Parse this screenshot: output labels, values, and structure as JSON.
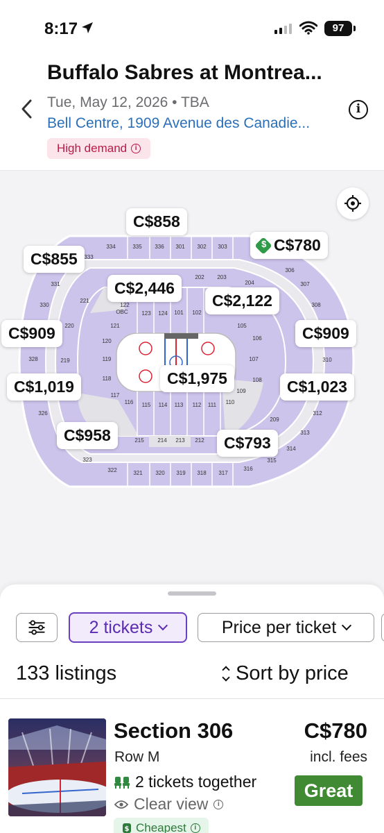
{
  "status_bar": {
    "time": "8:17",
    "battery": "97"
  },
  "header": {
    "title": "Buffalo Sabres at Montrea...",
    "date_time": "Tue, May 12, 2026 • TBA",
    "venue": "Bell Centre, 1909 Avenue des Canadie...",
    "demand_badge": "High demand",
    "icons": [
      "back-chevron-icon",
      "info-icon"
    ]
  },
  "map": {
    "section_labels": [
      "334",
      "335",
      "336",
      "301",
      "302",
      "303",
      "333",
      "306",
      "307",
      "308",
      "331",
      "330",
      "221",
      "220",
      "219",
      "122",
      "123",
      "124",
      "101",
      "102",
      "105",
      "106",
      "107",
      "108",
      "310",
      "121",
      "120",
      "119",
      "118",
      "117",
      "116",
      "115",
      "114",
      "113",
      "112",
      "111",
      "110",
      "109",
      "328",
      "326",
      "215",
      "214",
      "213",
      "212",
      "209",
      "313",
      "314",
      "315",
      "316",
      "317",
      "318",
      "319",
      "320",
      "321",
      "322",
      "323",
      "312",
      "202",
      "203",
      "204",
      "OBC"
    ],
    "price_tags": [
      {
        "label": "C$858",
        "deal": false
      },
      {
        "label": "C$780",
        "deal": true
      },
      {
        "label": "C$855",
        "deal": false
      },
      {
        "label": "C$2,446",
        "deal": false
      },
      {
        "label": "C$2,122",
        "deal": false
      },
      {
        "label": "C$909",
        "deal": false
      },
      {
        "label": "C$909",
        "deal": false
      },
      {
        "label": "C$1,975",
        "deal": false
      },
      {
        "label": "C$1,019",
        "deal": false
      },
      {
        "label": "C$1,023",
        "deal": false
      },
      {
        "label": "C$958",
        "deal": false
      },
      {
        "label": "C$793",
        "deal": false
      }
    ],
    "colors": {
      "available": "#cdc4ec",
      "unavailable": "#e3e3e7",
      "ice": "#ffffff",
      "accent": "#6c3fc0"
    }
  },
  "filters": {
    "tickets_label": "2 tickets",
    "price_mode_label": "Price per ticket",
    "listings_count": "133 listings",
    "sort_label": "Sort by price"
  },
  "listing": {
    "section": "Section 306",
    "row": "Row M",
    "price": "C$780",
    "fees": "incl. fees",
    "together": "2 tickets together",
    "view": "Clear view",
    "rating": "Great",
    "badge": "Cheapest",
    "rating_color": "#3f8a33"
  }
}
